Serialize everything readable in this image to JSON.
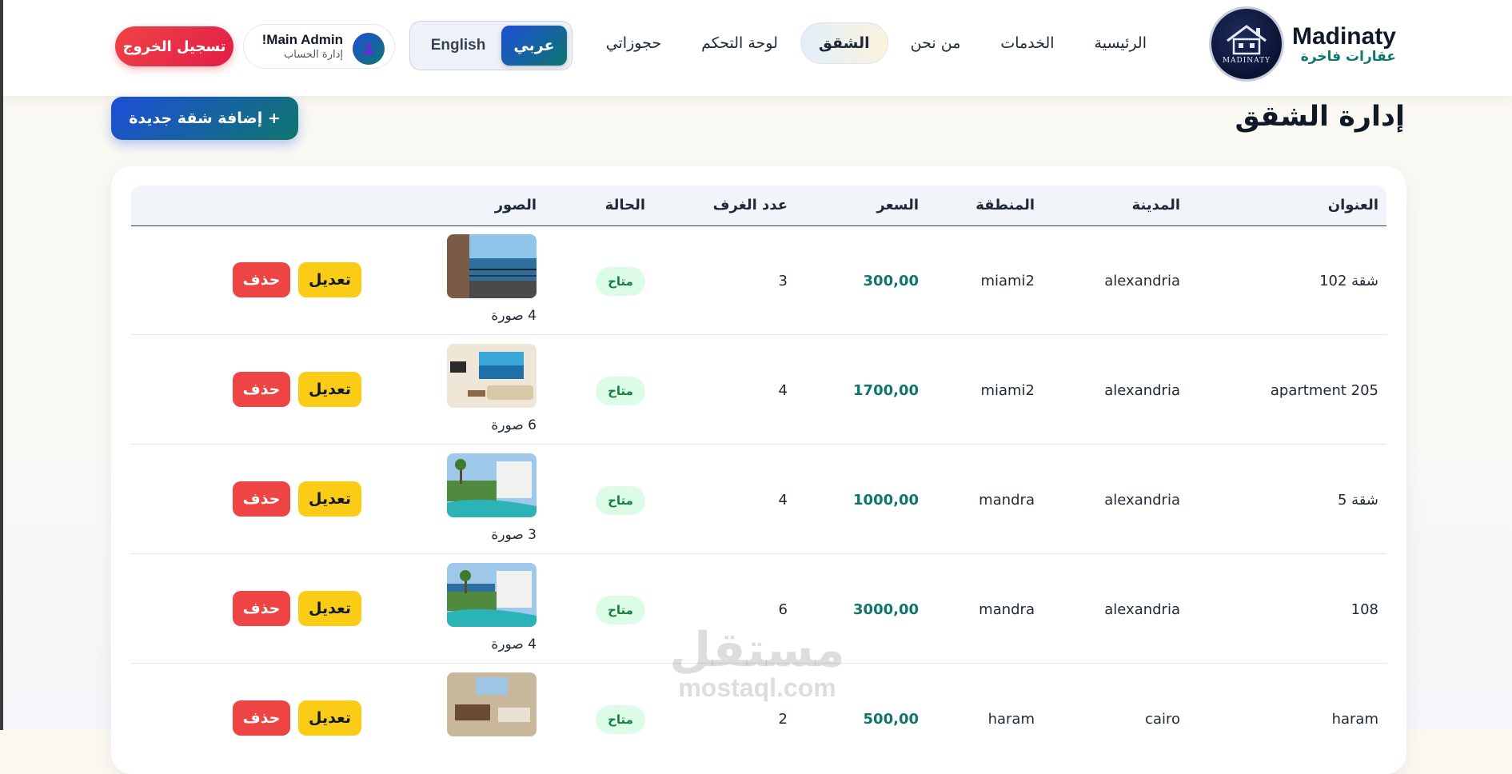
{
  "brand": {
    "name": "Madinaty",
    "subtitle": "عقارات فاخرة",
    "logo_text": "MADINATY"
  },
  "nav": {
    "home": "الرئيسية",
    "services": "الخدمات",
    "about": "من نحن",
    "apartments": "الشقق",
    "dashboard": "لوحة التحكم",
    "bookings": "حجوزاتي"
  },
  "lang": {
    "ar": "عربي",
    "en": "English"
  },
  "user": {
    "name": "Main Admin!",
    "sub": "إدارة الحساب"
  },
  "logout": "تسجيل الخروج",
  "page": {
    "title": "إدارة الشقق",
    "add_button": "+ إضافة شقة جديدة"
  },
  "table": {
    "headers": {
      "title": "العنوان",
      "city": "المدينة",
      "area": "المنطقة",
      "price": "السعر",
      "rooms": "عدد الغرف",
      "status": "الحالة",
      "images": "الصور"
    },
    "rows": [
      {
        "title": "شقة 102",
        "city": "alexandria",
        "area": "miami2",
        "price": "300,00",
        "rooms": "3",
        "status": "متاح",
        "images": "4 صورة",
        "edit": "تعديل",
        "delete": "حذف"
      },
      {
        "title": "apartment 205",
        "city": "alexandria",
        "area": "miami2",
        "price": "1700,00",
        "rooms": "4",
        "status": "متاح",
        "images": "6 صورة",
        "edit": "تعديل",
        "delete": "حذف"
      },
      {
        "title": "شقة 5",
        "city": "alexandria",
        "area": "mandra",
        "price": "1000,00",
        "rooms": "4",
        "status": "متاح",
        "images": "3 صورة",
        "edit": "تعديل",
        "delete": "حذف"
      },
      {
        "title": "108",
        "city": "alexandria",
        "area": "mandra",
        "price": "3000,00",
        "rooms": "6",
        "status": "متاح",
        "images": "4 صورة",
        "edit": "تعديل",
        "delete": "حذف"
      },
      {
        "title": "haram",
        "city": "cairo",
        "area": "haram",
        "price": "500,00",
        "rooms": "2",
        "status": "متاح",
        "images": "",
        "edit": "تعديل",
        "delete": "حذف"
      }
    ]
  },
  "watermark": {
    "line1": "مستقل",
    "line2": "mostaql.com"
  },
  "colors": {
    "accent_blue": "#1d4ed8",
    "accent_teal": "#0f766e",
    "danger": "#ef4444",
    "warning": "#facc15",
    "success_bg": "#dcfce7"
  }
}
